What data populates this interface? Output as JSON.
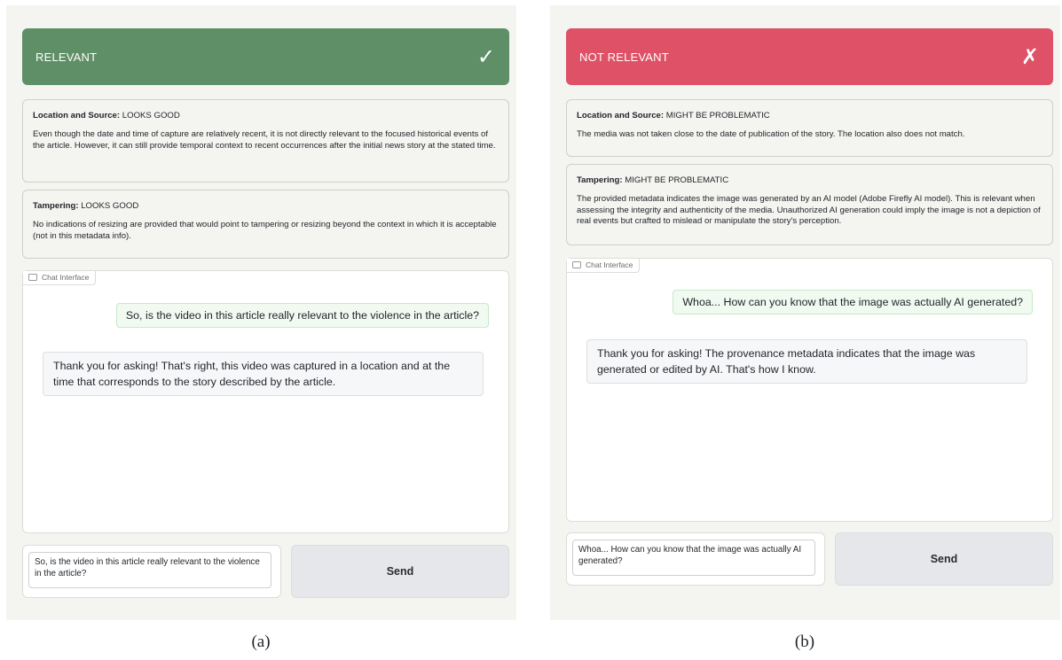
{
  "panels": [
    {
      "caption": "(a)",
      "banner": {
        "label": "RELEVANT",
        "mark": "✓",
        "color": "#5f8f67",
        "icon": "check-icon"
      },
      "cards": [
        {
          "title": "Location and Source:",
          "status": "LOOKS GOOD",
          "body": "Even though the date and time of capture are relatively recent, it is not directly relevant to the focused historical events of the article. However, it can still provide temporal context to recent occurrences after the initial news story at the stated time."
        },
        {
          "title": "Tampering:",
          "status": "LOOKS GOOD",
          "body": "No indications of resizing are provided that would point to tampering or resizing beyond the context in which it is acceptable (not in this metadata info)."
        }
      ],
      "chat": {
        "tab_label": "Chat Interface",
        "user_message": "So, is the video in this article really relevant to the violence in the article?",
        "bot_message": "Thank you for asking! That's right, this video was captured in a location and at the time that corresponds to the story described by the article."
      },
      "input_value": "So, is the video in this article really relevant to the violence in the article?",
      "send_label": "Send"
    },
    {
      "caption": "(b)",
      "banner": {
        "label": "NOT RELEVANT",
        "mark": "✗",
        "color": "#de5166",
        "icon": "cross-icon"
      },
      "cards": [
        {
          "title": "Location and Source:",
          "status": "MIGHT BE PROBLEMATIC",
          "body": "The media was not taken close to the date of publication of the story. The location also does not match."
        },
        {
          "title": "Tampering:",
          "status": "MIGHT BE PROBLEMATIC",
          "body": "The provided metadata indicates the image was generated by an AI model (Adobe Firefly AI model). This is relevant when assessing the integrity and authenticity of the media. Unauthorized AI generation could imply the image is not a depiction of real events but crafted to mislead or manipulate the story's perception."
        }
      ],
      "chat": {
        "tab_label": "Chat Interface",
        "user_message": "Whoa... How can you know that the image was actually AI generated?",
        "bot_message": "Thank you for asking! The provenance metadata indicates that the image was generated or edited by AI. That's how I know."
      },
      "input_value": "Whoa... How can you know that the image was actually AI generated?",
      "send_label": "Send"
    }
  ]
}
